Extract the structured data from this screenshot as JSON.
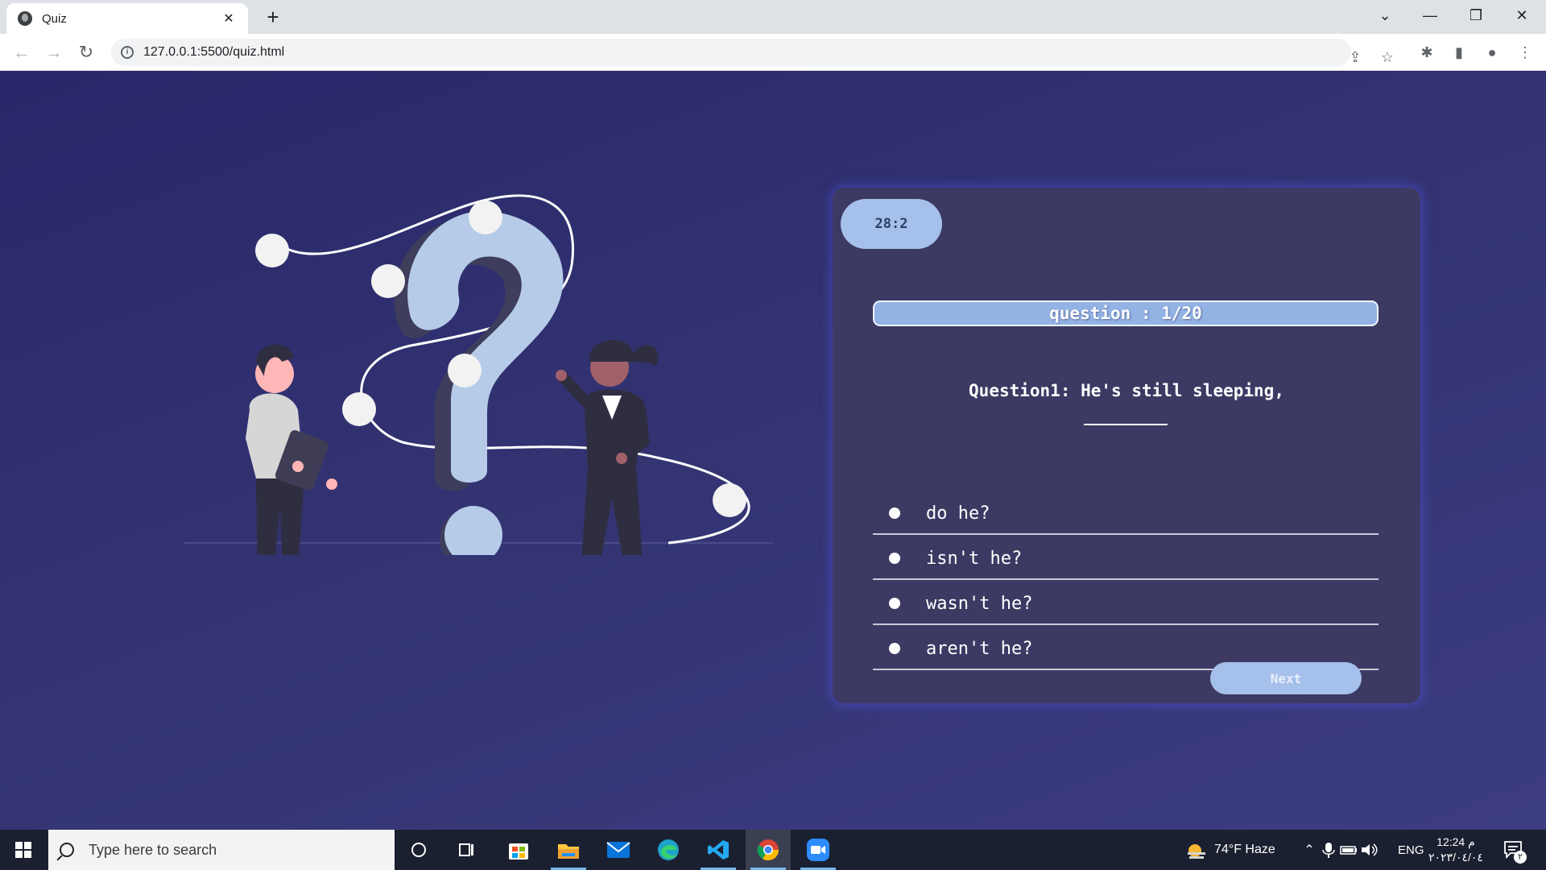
{
  "browser": {
    "tab_title": "Quiz",
    "tab_close": "✕",
    "new_tab": "+",
    "url": "127.0.0.1:5500/quiz.html",
    "controls": {
      "tab_search": "⌄",
      "minimize": "—",
      "restore": "❐",
      "close": "✕"
    },
    "nav": {
      "back": "←",
      "forward": "→",
      "reload": "↻"
    },
    "info_glyph": "i",
    "toolbar_glyphs": {
      "share": "⇪",
      "bookmark": "☆",
      "extensions": "✱",
      "side_panel": "▮",
      "profile": "●",
      "menu": "⋮"
    }
  },
  "quiz": {
    "timer": "28:2",
    "progress": "question : 1/20",
    "progress_fraction": 0.05,
    "question_text": "Question1: He's still sleeping,",
    "answers": [
      {
        "text": "do he?"
      },
      {
        "text": "isn't he?"
      },
      {
        "text": "wasn't he?"
      },
      {
        "text": "aren't he?"
      }
    ],
    "next_label": "Next"
  },
  "taskbar": {
    "search_placeholder": "Type here to search",
    "weather": "74°F  Haze",
    "language": "ENG",
    "time": "12:24 م",
    "date": "٢٠٢٣/٠٤/٠٤",
    "notification_count": "٢"
  },
  "colors": {
    "page_bg": "#2e2e6e",
    "card_bg": "#3c3a63",
    "accent": "#a5c0ea",
    "illustration_primary": "#b5cbe8",
    "figure_dark": "#2f2e41",
    "skin": "#ffb6b6"
  },
  "icons": [
    "globe-icon",
    "info-icon",
    "share-icon",
    "star-icon",
    "puzzle-icon",
    "side-panel-icon",
    "profile-icon",
    "menu-icon",
    "windows-icon",
    "search-icon",
    "cortana-icon",
    "task-view-icon",
    "store-icon",
    "file-explorer-icon",
    "mail-icon",
    "edge-icon",
    "vscode-icon",
    "chrome-icon",
    "zoom-icon",
    "weather-icon",
    "chevron-up-icon",
    "microphone-icon",
    "battery-icon",
    "speaker-icon",
    "notification-icon"
  ]
}
